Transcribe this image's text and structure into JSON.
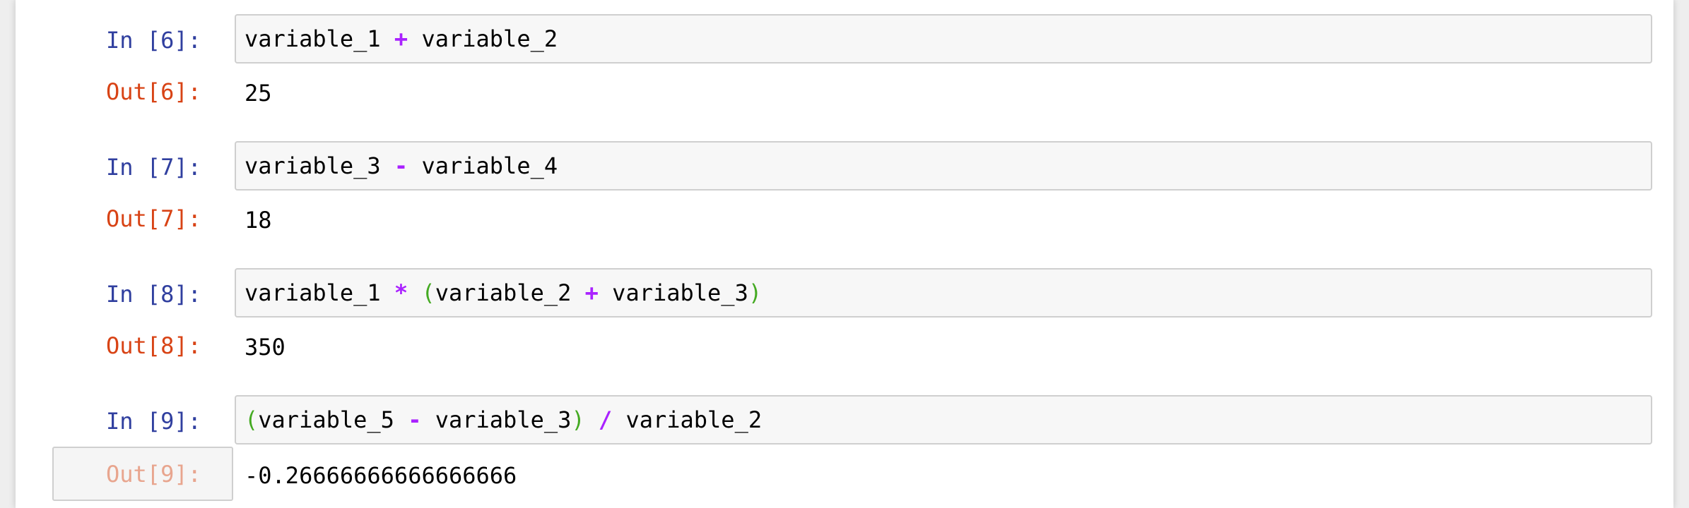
{
  "colors": {
    "in_prompt": "#303f9f",
    "out_prompt": "#d84315",
    "operator": "#aa22ff",
    "paren": "#44aa22"
  },
  "cells": [
    {
      "in_label": "In [6]:",
      "code_tokens": [
        {
          "t": "variable_1",
          "k": "name"
        },
        {
          "t": " ",
          "k": "space"
        },
        {
          "t": "+",
          "k": "op"
        },
        {
          "t": " ",
          "k": "space"
        },
        {
          "t": "variable_2",
          "k": "name"
        }
      ],
      "out_label": "Out[6]:",
      "output": "25"
    },
    {
      "in_label": "In [7]:",
      "code_tokens": [
        {
          "t": "variable_3",
          "k": "name"
        },
        {
          "t": " ",
          "k": "space"
        },
        {
          "t": "-",
          "k": "op"
        },
        {
          "t": " ",
          "k": "space"
        },
        {
          "t": "variable_4",
          "k": "name"
        }
      ],
      "out_label": "Out[7]:",
      "output": "18"
    },
    {
      "in_label": "In [8]:",
      "code_tokens": [
        {
          "t": "variable_1",
          "k": "name"
        },
        {
          "t": " ",
          "k": "space"
        },
        {
          "t": "*",
          "k": "op"
        },
        {
          "t": " ",
          "k": "space"
        },
        {
          "t": "(",
          "k": "paren"
        },
        {
          "t": "variable_2",
          "k": "name"
        },
        {
          "t": " ",
          "k": "space"
        },
        {
          "t": "+",
          "k": "op"
        },
        {
          "t": " ",
          "k": "space"
        },
        {
          "t": "variable_3",
          "k": "name"
        },
        {
          "t": ")",
          "k": "paren"
        }
      ],
      "out_label": "Out[8]:",
      "output": "350"
    },
    {
      "in_label": "In [9]:",
      "code_tokens": [
        {
          "t": "(",
          "k": "paren"
        },
        {
          "t": "variable_5",
          "k": "name"
        },
        {
          "t": " ",
          "k": "space"
        },
        {
          "t": "-",
          "k": "op"
        },
        {
          "t": " ",
          "k": "space"
        },
        {
          "t": "variable_3",
          "k": "name"
        },
        {
          "t": ")",
          "k": "paren"
        },
        {
          "t": " ",
          "k": "space"
        },
        {
          "t": "/",
          "k": "op"
        },
        {
          "t": " ",
          "k": "space"
        },
        {
          "t": "variable_2",
          "k": "name"
        }
      ],
      "out_label": "Out[9]:",
      "output": "-0.26666666666666666"
    }
  ]
}
